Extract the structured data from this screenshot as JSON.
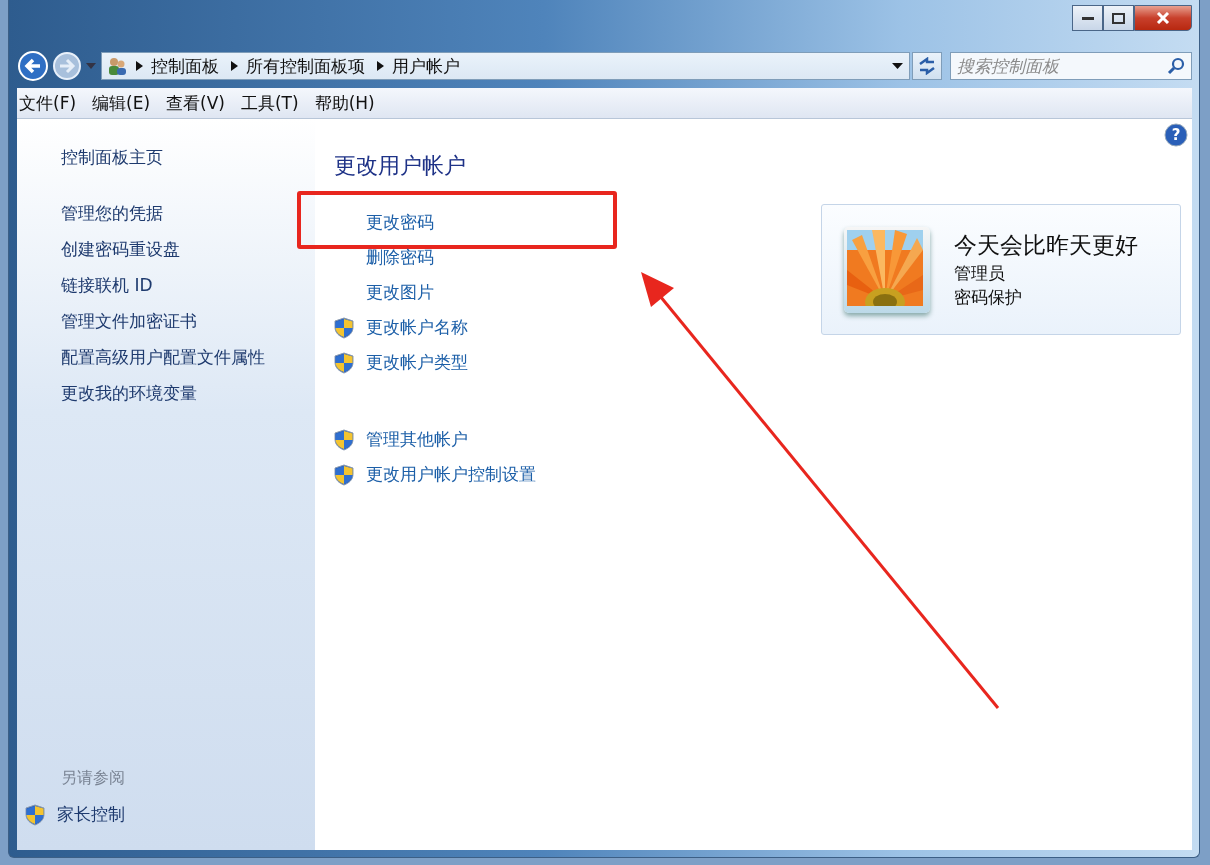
{
  "address_bar": {
    "breadcrumbs": [
      "控制面板",
      "所有控制面板项",
      "用户帐户"
    ]
  },
  "search": {
    "placeholder": "搜索控制面板"
  },
  "help_button": "?",
  "menu": [
    "文件(F)",
    "编辑(E)",
    "查看(V)",
    "工具(T)",
    "帮助(H)"
  ],
  "sidebar": {
    "home": "控制面板主页",
    "items": [
      "管理您的凭据",
      "创建密码重设盘",
      "链接联机 ID",
      "管理文件加密证书",
      "配置高级用户配置文件属性",
      "更改我的环境变量"
    ],
    "see_also": {
      "title": "另请参阅",
      "items": [
        {
          "label": "家长控制",
          "shield": true
        }
      ]
    }
  },
  "main": {
    "title": "更改用户帐户",
    "groups": [
      [
        {
          "label": "更改密码",
          "shield": false,
          "annotated": true
        },
        {
          "label": "删除密码",
          "shield": false,
          "annotated": false
        },
        {
          "label": "更改图片",
          "shield": false,
          "annotated": false
        },
        {
          "label": "更改帐户名称",
          "shield": true,
          "annotated": false
        },
        {
          "label": "更改帐户类型",
          "shield": true,
          "annotated": false
        }
      ],
      [
        {
          "label": "管理其他帐户",
          "shield": true,
          "annotated": false
        },
        {
          "label": "更改用户帐户控制设置",
          "shield": true,
          "annotated": false
        }
      ]
    ]
  },
  "account": {
    "name": "今天会比昨天更好",
    "lines": [
      "管理员",
      "密码保护"
    ]
  }
}
